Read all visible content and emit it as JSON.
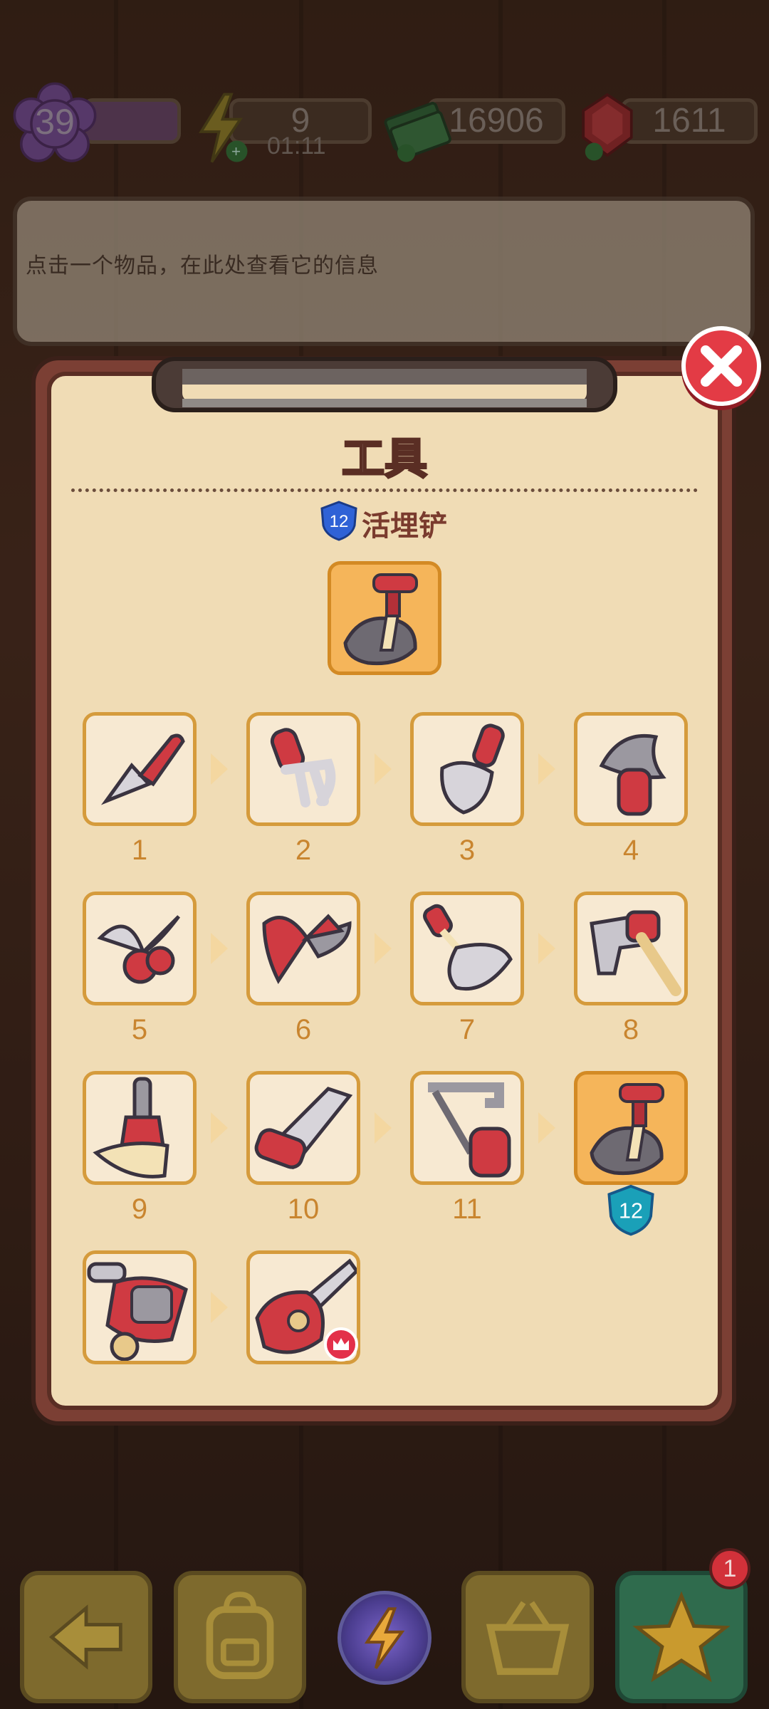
{
  "hud": {
    "level": "39",
    "energy": "9",
    "energy_timer": "01:11",
    "cash": "16906",
    "gems": "1611"
  },
  "info_box": {
    "text": "点击一个物品，在此处查看它的信息"
  },
  "panel": {
    "title": "工具",
    "current_item": {
      "level_badge": "12",
      "name": "活埋铲"
    },
    "items": [
      {
        "level": "1",
        "name": "trowel"
      },
      {
        "level": "2",
        "name": "hand fork"
      },
      {
        "level": "3",
        "name": "spade"
      },
      {
        "level": "4",
        "name": "axe"
      },
      {
        "level": "5",
        "name": "pruning shears"
      },
      {
        "level": "6",
        "name": "secateurs"
      },
      {
        "level": "7",
        "name": "rake"
      },
      {
        "level": "8",
        "name": "mallet"
      },
      {
        "level": "9",
        "name": "broom"
      },
      {
        "level": "10",
        "name": "hand saw"
      },
      {
        "level": "11",
        "name": "hacksaw"
      },
      {
        "level": "12",
        "name": "活埋铲"
      },
      {
        "level": "",
        "name": "lawn mower"
      },
      {
        "level": "",
        "name": "chainsaw"
      }
    ],
    "current_badge": "12"
  },
  "bottom_bar": {
    "notification_count": "1"
  },
  "colors": {
    "accent_red": "#e33b45",
    "panel_cream": "#f0dcb5",
    "cell_border": "#d59b3c",
    "number_orange": "#c9852f",
    "badge_blue": "#2f62d6"
  }
}
